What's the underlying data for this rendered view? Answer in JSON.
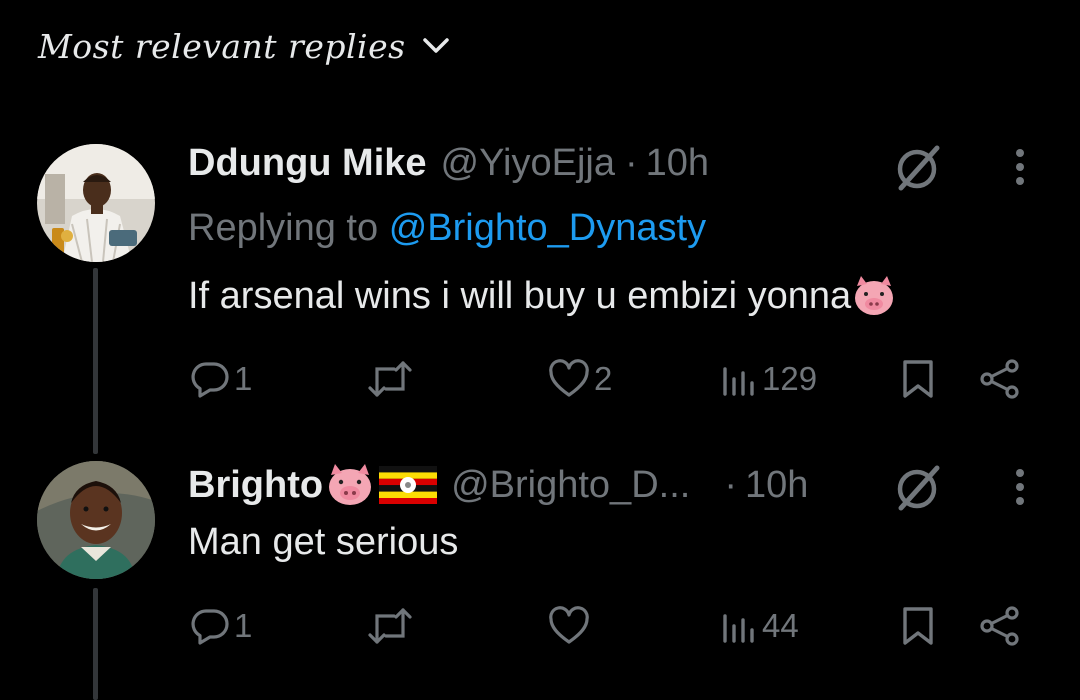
{
  "header": {
    "sort_label": "Most relevant replies",
    "chevron_icon": "chevron-down-icon"
  },
  "tweets": [
    {
      "display_name": "Ddungu Mike",
      "handle": "@YiyoEjja",
      "separator": "·",
      "time": "10h",
      "replying_prefix": "Replying to",
      "replying_to": "@Brighto_Dynasty",
      "text": "If arsenal wins i will buy u embizi yonna",
      "text_emoji": "pig-face-emoji",
      "stats": {
        "replies": "1",
        "retweets": "",
        "likes": "2",
        "views": "129"
      }
    },
    {
      "display_name": "Brighto",
      "name_emojis": [
        "pig-face-emoji",
        "uganda-flag-emoji"
      ],
      "handle": "@Brighto_D...",
      "separator": "·",
      "time": "10h",
      "text": "Man get serious",
      "stats": {
        "replies": "1",
        "retweets": "",
        "likes": "",
        "views": "44"
      }
    }
  ],
  "colors": {
    "background": "#000000",
    "text": "#e7e9ea",
    "muted": "#71767b",
    "link": "#1d9bf0",
    "thread_line": "#333639"
  }
}
